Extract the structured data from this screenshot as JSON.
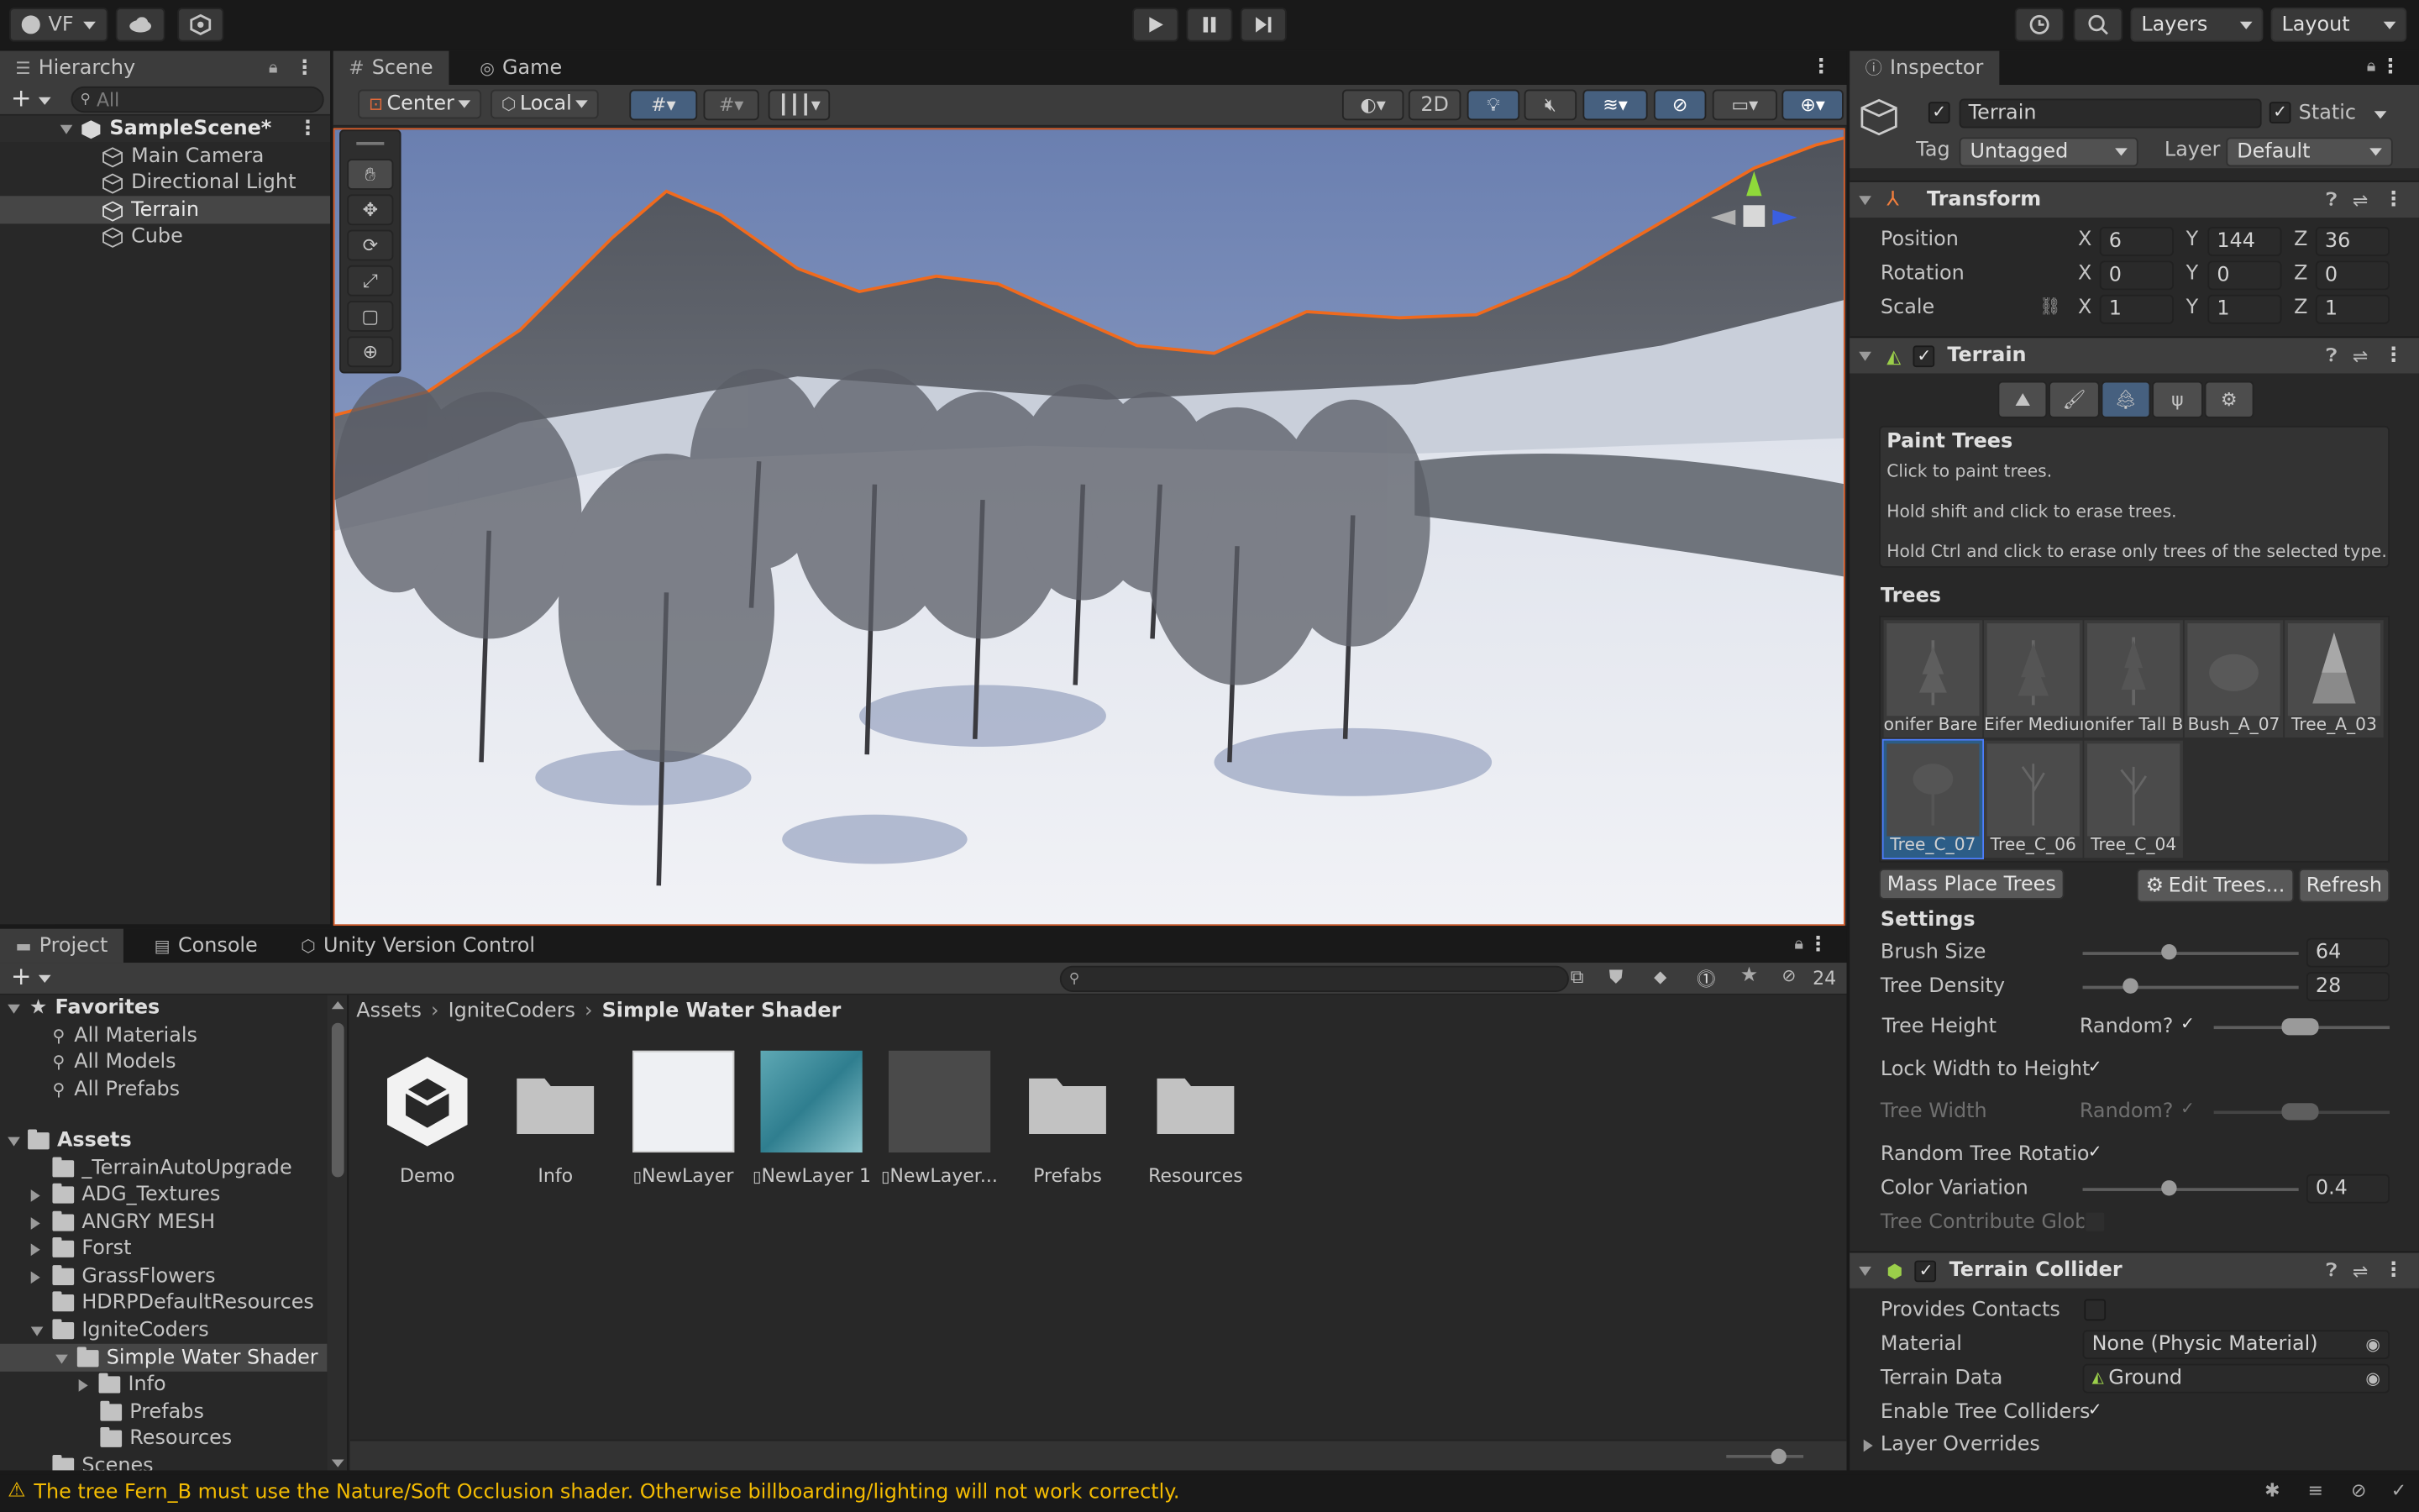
{
  "toolbar": {
    "account": "VF",
    "layers": "Layers",
    "layout": "Layout"
  },
  "hierarchy": {
    "tab": "Hierarchy",
    "search_placeholder": "All",
    "scene": "SampleScene*",
    "items": [
      "Main Camera",
      "Directional Light",
      "Terrain",
      "Cube"
    ],
    "selected": "Terrain"
  },
  "scene_view": {
    "tabs": [
      "Scene",
      "Game"
    ],
    "pivot": "Center",
    "space": "Local",
    "mode_2d": "2D"
  },
  "inspector": {
    "tab": "Inspector",
    "object_name": "Terrain",
    "static_label": "Static",
    "tag_label": "Tag",
    "tag_value": "Untagged",
    "layer_label": "Layer",
    "layer_value": "Default",
    "transform": {
      "title": "Transform",
      "position_label": "Position",
      "rotation_label": "Rotation",
      "scale_label": "Scale",
      "position": {
        "x": "6",
        "y": "144",
        "z": "36"
      },
      "rotation": {
        "x": "0",
        "y": "0",
        "z": "0"
      },
      "scale": {
        "x": "1",
        "y": "1",
        "z": "1"
      }
    },
    "terrain": {
      "title": "Terrain",
      "help_title": "Paint Trees",
      "help_lines": [
        "Click to paint trees.",
        "Hold shift and click to erase trees.",
        "Hold Ctrl and click to erase only trees of the selected type."
      ],
      "trees_label": "Trees",
      "trees": [
        "onifer Bare B",
        "Eifer Medium",
        "onifer Tall B",
        "Bush_A_07",
        "Tree_A_03",
        "Tree_C_07",
        "Tree_C_06",
        "Tree_C_04"
      ],
      "selected_tree": "Tree_C_07",
      "mass_place": "Mass Place Trees",
      "edit_trees": "Edit Trees...",
      "refresh": "Refresh",
      "settings_label": "Settings",
      "brush_size_label": "Brush Size",
      "brush_size": "64",
      "brush_size_level": 0.4,
      "tree_density_label": "Tree Density",
      "tree_density": "28",
      "tree_density_level": 0.22,
      "tree_height_label": "Tree Height",
      "random_label": "Random?",
      "lock_width_label": "Lock Width to Height",
      "tree_width_label": "Tree Width",
      "random_rotation_label": "Random Tree Rotatio",
      "color_variation_label": "Color Variation",
      "color_variation": "0.4",
      "color_variation_level": 0.4,
      "contribute_gi_label": "Tree Contribute Globa"
    },
    "collider": {
      "title": "Terrain Collider",
      "provides_contacts_label": "Provides Contacts",
      "material_label": "Material",
      "material_value": "None (Physic Material)",
      "terrain_data_label": "Terrain Data",
      "terrain_data_value": "Ground",
      "enable_tree_colliders_label": "Enable Tree Colliders",
      "layer_overrides_label": "Layer Overrides"
    }
  },
  "project": {
    "tabs": [
      "Project",
      "Console",
      "Unity Version Control"
    ],
    "hidden_count": "24",
    "favorites_label": "Favorites",
    "favorites": [
      "All Materials",
      "All Models",
      "All Prefabs"
    ],
    "assets_label": "Assets",
    "folders": [
      "_TerrainAutoUpgrade",
      "ADG_Textures",
      "ANGRY MESH",
      "Forst",
      "GrassFlowers",
      "HDRPDefaultResources",
      "IgniteCoders",
      "Simple Water Shader",
      "Info",
      "Prefabs",
      "Resources",
      "Scenes"
    ],
    "breadcrumb": [
      "Assets",
      "IgniteCoders",
      "Simple Water Shader"
    ],
    "assets": [
      "Demo",
      "Info",
      "NewLayer",
      "NewLayer 1",
      "NewLayer...",
      "Prefabs",
      "Resources"
    ]
  },
  "status": {
    "message": "The tree Fern_B must use the Nature/Soft Occlusion shader. Otherwise billboarding/lighting will not work correctly."
  },
  "colors": {
    "accent": "#4c7fff",
    "selection": "#2c5d87",
    "warning": "#f4bc02",
    "selection_outline": "#f06a1d"
  }
}
